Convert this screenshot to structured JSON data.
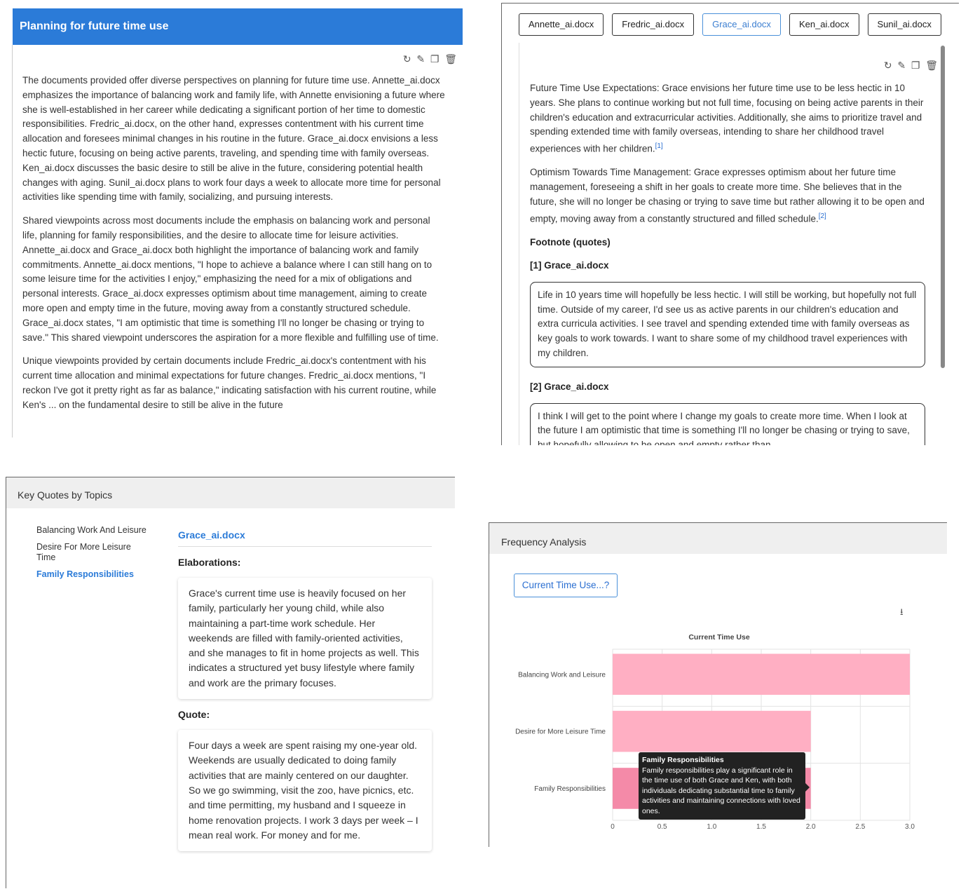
{
  "planning": {
    "title": "Planning for future time use",
    "paragraphs": [
      "The documents provided offer diverse perspectives on planning for future time use. Annette_ai.docx emphasizes the importance of balancing work and family life, with Annette envisioning a future where she is well-established in her career while dedicating a significant portion of her time to domestic responsibilities. Fredric_ai.docx, on the other hand, expresses contentment with his current time allocation and foresees minimal changes in his routine in the future. Grace_ai.docx envisions a less hectic future, focusing on being active parents, traveling, and spending time with family overseas. Ken_ai.docx discusses the basic desire to still be alive in the future, considering potential health changes with aging. Sunil_ai.docx plans to work four days a week to allocate more time for personal activities like spending time with family, socializing, and pursuing interests.",
      "Shared viewpoints across most documents include the emphasis on balancing work and personal life, planning for family responsibilities, and the desire to allocate time for leisure activities. Annette_ai.docx and Grace_ai.docx both highlight the importance of balancing work and family commitments. Annette_ai.docx mentions, \"I hope to achieve a balance where I can still hang on to some leisure time for the activities I enjoy,\" emphasizing the need for a mix of obligations and personal interests. Grace_ai.docx expresses optimism about time management, aiming to create more open and empty time in the future, moving away from a constantly structured schedule. Grace_ai.docx states, \"I am optimistic that time is something I'll no longer be chasing or trying to save.\" This shared viewpoint underscores the aspiration for a more flexible and fulfilling use of time.",
      "Unique viewpoints provided by certain documents include Fredric_ai.docx's contentment with his current time allocation and minimal expectations for future changes. Fredric_ai.docx mentions, \"I reckon I've got it pretty right as far as balance,\" indicating satisfaction with his current routine, while Ken's ... on the fundamental desire to still be alive in the future"
    ]
  },
  "docs": {
    "tabs": [
      "Annette_ai.docx",
      "Fredric_ai.docx",
      "Grace_ai.docx",
      "Ken_ai.docx",
      "Sunil_ai.docx"
    ],
    "active_tab": "Grace_ai.docx",
    "para1": "Future Time Use Expectations: Grace envisions her future time use to be less hectic in 10 years. She plans to continue working but not full time, focusing on being active parents in their children's education and extracurricular activities. Additionally, she aims to prioritize travel and spending extended time with family overseas, intending to share her childhood travel experiences with her children.",
    "para1_ref": "[1]",
    "para2": "Optimism Towards Time Management: Grace expresses optimism about her future time management, foreseeing a shift in her goals to create more time. She believes that in the future, she will no longer be chasing or trying to save time but rather allowing it to be open and empty, moving away from a constantly structured and filled schedule.",
    "para2_ref": "[2]",
    "footnote_heading": "Footnote (quotes)",
    "fn1_label": "[1] Grace_ai.docx",
    "fn1_text": "Life in 10 years time will hopefully be less hectic. I will still be working, but hopefully not full time. Outside of my career, I'd see us as active parents in our children's education and extra curricula activities. I see travel and spending extended time with family overseas as key goals to work towards. I want to share some of my childhood travel experiences with my children.",
    "fn2_label": "[2] Grace_ai.docx",
    "fn2_text": "I think I will get to the point where I change my goals to create more time. When I look at the future I am optimistic that time is something I'll no longer be chasing or trying to save, but hopefully allowing to be open and empty rather than"
  },
  "quotes": {
    "header": "Key Quotes by Topics",
    "topics": [
      "Balancing Work And Leisure",
      "Desire For More Leisure Time",
      "Family Responsibilities"
    ],
    "active_topic": "Family Responsibilities",
    "doc_title": "Grace_ai.docx",
    "elaborations_label": "Elaborations:",
    "elaboration": "Grace's current time use is heavily focused on her family, particularly her young child, while also maintaining a part-time work schedule. Her weekends are filled with family-oriented activities, and she manages to fit in home projects as well. This indicates a structured yet busy lifestyle where family and work are the primary focuses.",
    "quote_label": "Quote:",
    "quote": "Four days a week are spent raising my one-year old. Weekends are usually dedicated to doing family activities that are mainly centered on our daughter. So we go swimming, visit the zoo, have picnics, etc. and time permitting, my husband and I squeeze in home renovation projects. I work 3 days per week – I mean real work. For money and for me."
  },
  "frequency": {
    "header": "Frequency Analysis",
    "button_label": "Current Time Use...?",
    "tooltip_title": "Family Responsibilities",
    "tooltip_text": "Family responsibilities play a significant role in the time use of both Grace and Ken, with both individuals dedicating substantial time to family activities and maintaining connections with loved ones."
  },
  "chart_data": {
    "type": "bar",
    "orientation": "horizontal",
    "title": "Current Time Use",
    "categories": [
      "Balancing Work and Leisure",
      "Desire for More Leisure Time",
      "Family Responsibilities"
    ],
    "values": [
      3,
      2,
      2
    ],
    "xlim": [
      0,
      3
    ],
    "xticks": [
      "0",
      "0.5",
      "1.0",
      "1.5",
      "2.0",
      "2.5",
      "3.0"
    ],
    "grid": true,
    "bar_color": "#ffafc3",
    "highlight_color": "#f48aa8"
  }
}
